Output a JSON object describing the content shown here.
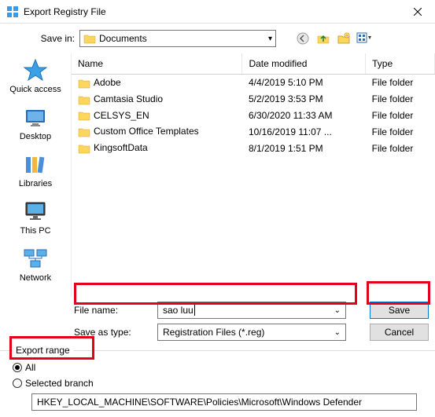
{
  "window": {
    "title": "Export Registry File"
  },
  "savein": {
    "label": "Save in:",
    "value": "Documents"
  },
  "columns": {
    "name": "Name",
    "date": "Date modified",
    "type": "Type"
  },
  "rows": [
    {
      "name": "Adobe",
      "date": "4/4/2019 5:10 PM",
      "type": "File folder"
    },
    {
      "name": "Camtasia Studio",
      "date": "5/2/2019 3:53 PM",
      "type": "File folder"
    },
    {
      "name": "CELSYS_EN",
      "date": "6/30/2020 11:33 AM",
      "type": "File folder"
    },
    {
      "name": "Custom Office Templates",
      "date": "10/16/2019 11:07 ...",
      "type": "File folder"
    },
    {
      "name": "KingsoftData",
      "date": "8/1/2019 1:51 PM",
      "type": "File folder"
    }
  ],
  "places": {
    "quickaccess": "Quick access",
    "desktop": "Desktop",
    "libraries": "Libraries",
    "thispc": "This PC",
    "network": "Network"
  },
  "fields": {
    "filename_label": "File name:",
    "filename_value": "sao luu",
    "saveastype_label": "Save as type:",
    "saveastype_value": "Registration Files (*.reg)"
  },
  "buttons": {
    "save": "Save",
    "cancel": "Cancel"
  },
  "export": {
    "legend": "Export range",
    "all": "All",
    "selected": "Selected branch",
    "branch_path": "HKEY_LOCAL_MACHINE\\SOFTWARE\\Policies\\Microsoft\\Windows Defender"
  }
}
